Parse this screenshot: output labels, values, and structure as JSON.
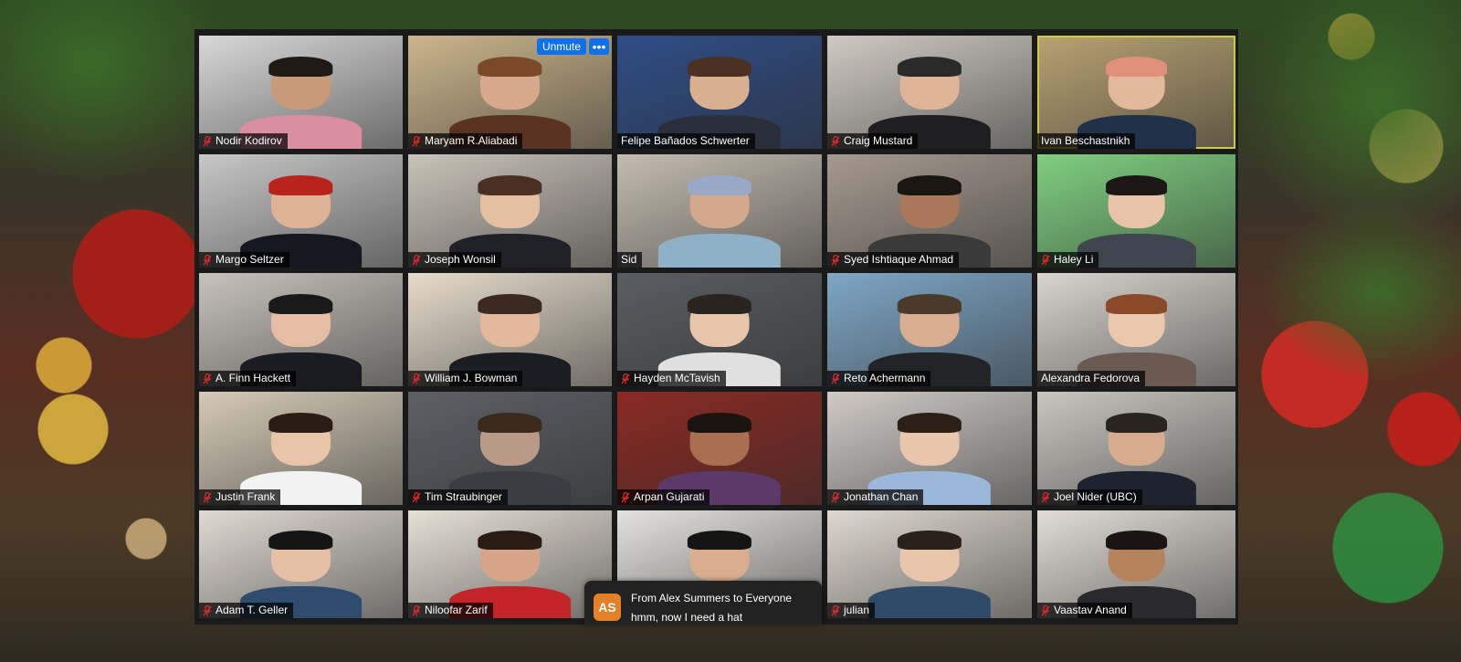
{
  "meeting": {
    "participants": [
      {
        "name": "Nodir Kodirov",
        "muted": true,
        "bg": "#d8d8d8",
        "skin": "#c99a78",
        "shirt": "#d98fa0",
        "hair": "#1f1a16"
      },
      {
        "name": "Maryam R.Aliabadi",
        "muted": true,
        "bg": "#cbb58c",
        "skin": "#d7a98a",
        "shirt": "#5a3222",
        "hair": "#7a4a28"
      },
      {
        "name": "Felipe Bañados Schwerter",
        "muted": false,
        "bg": "#2f4d86",
        "skin": "#d9b08f",
        "shirt": "#2b2f3a",
        "hair": "#4a3020"
      },
      {
        "name": "Craig Mustard",
        "muted": true,
        "bg": "#cfcac2",
        "skin": "#e0b497",
        "shirt": "#1f1f22",
        "hair": "#2a2a2a"
      },
      {
        "name": "Ivan Beschastnikh",
        "muted": false,
        "bg": "#b8a272",
        "skin": "#e2b99a",
        "shirt": "#22314a",
        "hair": "#e0907a"
      },
      {
        "name": "Margo Seltzer",
        "muted": true,
        "bg": "#c7c7c7",
        "skin": "#e0b295",
        "shirt": "#151820",
        "hair": "#b8231c"
      },
      {
        "name": "Joseph Wonsil",
        "muted": true,
        "bg": "#c9c2b8",
        "skin": "#e5bfa2",
        "shirt": "#202028",
        "hair": "#4a3022"
      },
      {
        "name": "Sid",
        "muted": false,
        "bg": "#c4bcb0",
        "skin": "#d3a88d",
        "shirt": "#8fb1c7",
        "hair": "#9aa8c8"
      },
      {
        "name": "Syed Ishtiaque Ahmad",
        "muted": true,
        "bg": "#a59a90",
        "skin": "#a9775a",
        "shirt": "#3a3a3a",
        "hair": "#1a1612"
      },
      {
        "name": "Haley Li",
        "muted": true,
        "bg": "#7fcf80",
        "skin": "#e8c3a8",
        "shirt": "#40464f",
        "hair": "#1c1714"
      },
      {
        "name": "A. Finn Hackett",
        "muted": true,
        "bg": "#c7c2bc",
        "skin": "#e4bda3",
        "shirt": "#1a1c22",
        "hair": "#1a1a1a"
      },
      {
        "name": "William J. Bowman",
        "muted": true,
        "bg": "#e6dccb",
        "skin": "#e3b89d",
        "shirt": "#1c1d22",
        "hair": "#3a2a20"
      },
      {
        "name": "Hayden McTavish",
        "muted": true,
        "bg": "#5a5e62",
        "skin": "#e7c4aa",
        "shirt": "#e0e0e0",
        "hair": "#2a241e"
      },
      {
        "name": "Reto Achermann",
        "muted": true,
        "bg": "#7fa7c6",
        "skin": "#d9ae90",
        "shirt": "#222428",
        "hair": "#4a3a2a"
      },
      {
        "name": "Alexandra Fedorova",
        "muted": false,
        "bg": "#d8d4ce",
        "skin": "#e9c8ae",
        "shirt": "#6a5a50",
        "hair": "#8a4a2a"
      },
      {
        "name": "Justin Frank",
        "muted": true,
        "bg": "#d4cab6",
        "skin": "#e8c4a8",
        "shirt": "#f2f2f2",
        "hair": "#2a1d15"
      },
      {
        "name": "Tim Straubinger",
        "muted": true,
        "bg": "#5d6066",
        "skin": "#b89a86",
        "shirt": "#3a3d44",
        "hair": "#3a2a1c"
      },
      {
        "name": "Arpan Gujarati",
        "muted": true,
        "bg": "#8a2a24",
        "skin": "#a87050",
        "shirt": "#5b3a6a",
        "hair": "#1a1410"
      },
      {
        "name": "Jonathan Chan",
        "muted": true,
        "bg": "#cfcac6",
        "skin": "#e8c6ac",
        "shirt": "#9bb7d9",
        "hair": "#2a2018"
      },
      {
        "name": "Joel Nider (UBC)",
        "muted": true,
        "bg": "#c9c6c0",
        "skin": "#d7ab8d",
        "shirt": "#1f2330",
        "hair": "#2a2420"
      },
      {
        "name": "Adam T. Geller",
        "muted": true,
        "bg": "#e0dad2",
        "skin": "#e5c0a5",
        "shirt": "#2f4b6e",
        "hair": "#141414"
      },
      {
        "name": "Niloofar Zarif",
        "muted": true,
        "bg": "#e6e0d6",
        "skin": "#d6a489",
        "shirt": "#c3242a",
        "hair": "#2a1a14"
      },
      {
        "name": "",
        "muted": false,
        "bg": "#e4e2de",
        "skin": "#d9ad8d",
        "shirt": "#2a2a30",
        "hair": "#141414"
      },
      {
        "name": "julian",
        "muted": true,
        "bg": "#ded8cf",
        "skin": "#e9c6ab",
        "shirt": "#304a6a",
        "hair": "#2a201a"
      },
      {
        "name": "Vaastav Anand",
        "muted": true,
        "bg": "#e1ddd6",
        "skin": "#b5845f",
        "shirt": "#2a2a2e",
        "hair": "#1a1512"
      }
    ],
    "controls": {
      "unmute_label": "Unmute",
      "more_label": "•••"
    },
    "chat_toast": {
      "avatar_initials": "AS",
      "from_line": "From Alex Summers to Everyone",
      "message": "hmm, now I need a hat",
      "avatar_color": "#e4802a"
    },
    "colors": {
      "mute_icon": "#e02828",
      "active_speaker_border": "#c9cf3a",
      "zoom_blue": "#0e71eb"
    }
  }
}
